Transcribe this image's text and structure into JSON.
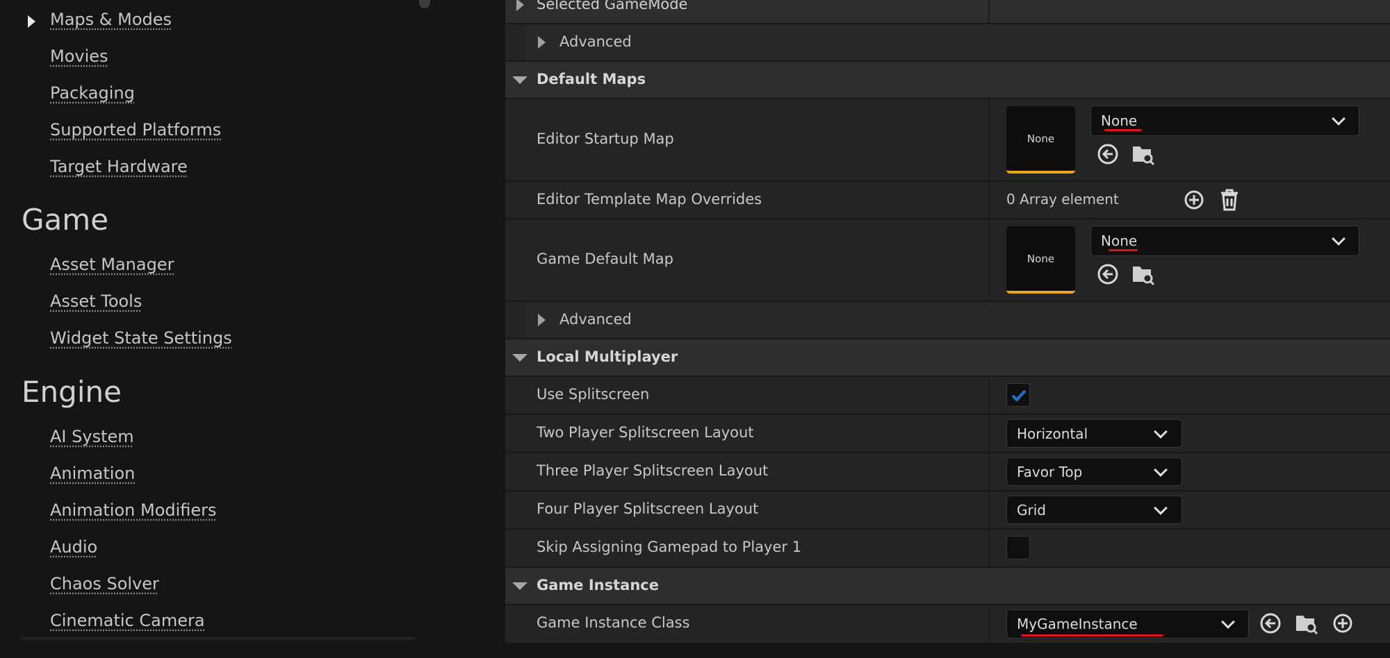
{
  "nav": {
    "items_top": [
      {
        "label": "Maps & Modes"
      },
      {
        "label": "Movies"
      },
      {
        "label": "Packaging"
      },
      {
        "label": "Supported Platforms"
      },
      {
        "label": "Target Hardware"
      }
    ],
    "game_heading": "Game",
    "game_items": [
      {
        "label": "Asset Manager"
      },
      {
        "label": "Asset Tools"
      },
      {
        "label": "Widget State Settings"
      }
    ],
    "engine_heading": "Engine",
    "engine_items": [
      {
        "label": "AI System"
      },
      {
        "label": "Animation"
      },
      {
        "label": "Animation Modifiers"
      },
      {
        "label": "Audio"
      },
      {
        "label": "Chaos Solver"
      },
      {
        "label": "Cinematic Camera"
      }
    ]
  },
  "details": {
    "selected_gamemode_label": "Selected GameMode",
    "advanced_label": "Advanced",
    "default_maps": {
      "title": "Default Maps",
      "editor_startup_map": {
        "label": "Editor Startup Map",
        "thumb": "None",
        "value": "None"
      },
      "editor_template_overrides": {
        "label": "Editor Template Map Overrides",
        "value": "0 Array element"
      },
      "game_default_map": {
        "label": "Game Default Map",
        "thumb": "None",
        "value": "None"
      }
    },
    "local_multiplayer": {
      "title": "Local Multiplayer",
      "use_splitscreen": {
        "label": "Use Splitscreen",
        "checked": true
      },
      "two_player": {
        "label": "Two Player Splitscreen Layout",
        "value": "Horizontal"
      },
      "three_player": {
        "label": "Three Player Splitscreen Layout",
        "value": "Favor Top"
      },
      "four_player": {
        "label": "Four Player Splitscreen Layout",
        "value": "Grid"
      },
      "skip_gamepad": {
        "label": "Skip Assigning Gamepad to Player 1",
        "checked": false
      }
    },
    "game_instance": {
      "title": "Game Instance",
      "class": {
        "label": "Game Instance Class",
        "value": "MyGameInstance"
      }
    }
  },
  "colors": {
    "accent_checkbox": "#1f72d6",
    "thumb_border": "#e8a623",
    "annotation_underline": "#e0141e"
  }
}
